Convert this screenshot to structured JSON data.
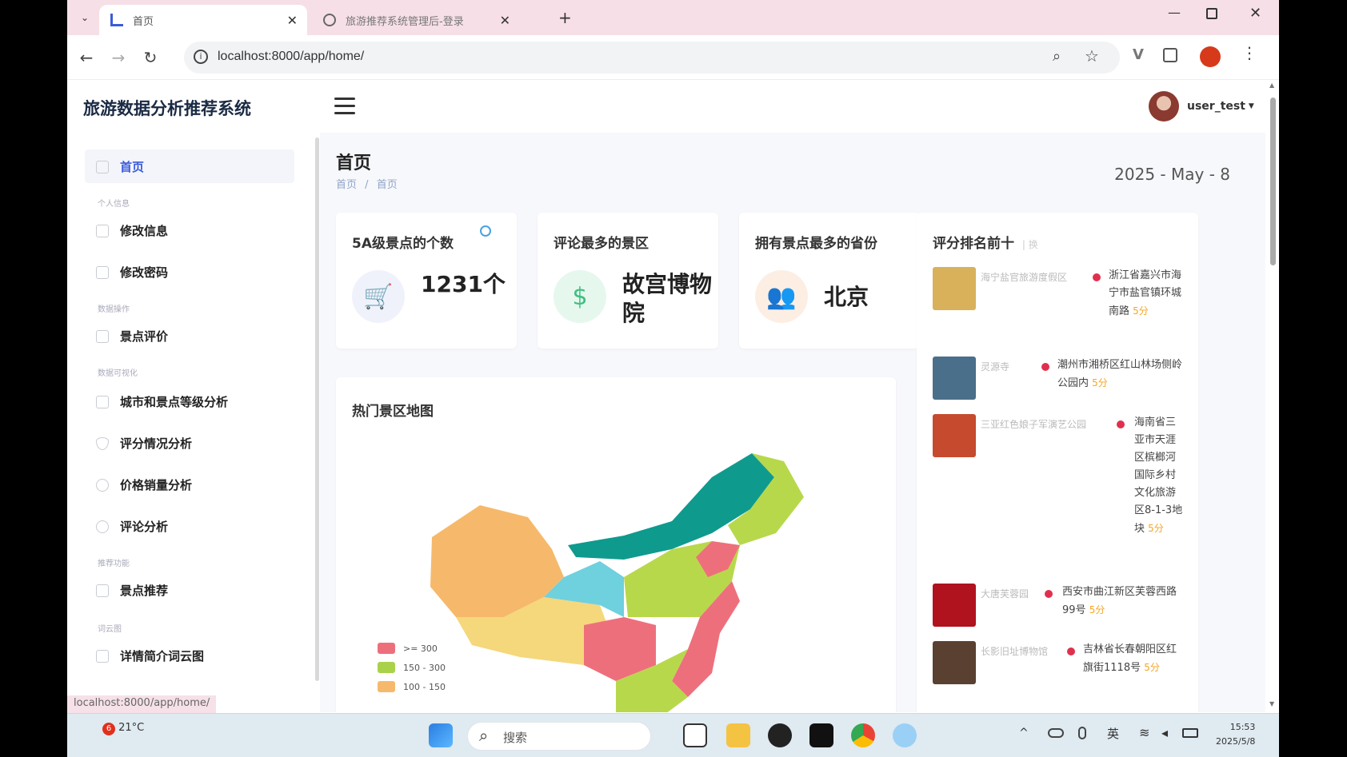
{
  "browser": {
    "tabs": [
      {
        "label": "首页",
        "active": true
      },
      {
        "label": "旅游推荐系统管理后-登录",
        "active": false
      }
    ],
    "new_tab": "+",
    "url": "localhost:8000/app/home/",
    "status_url": "localhost:8000/app/home/"
  },
  "app": {
    "title": "旅游数据分析推荐系统",
    "username": "user_test"
  },
  "sidebar": {
    "items": [
      {
        "label": "首页",
        "icon": "grid-icon"
      },
      {
        "label": "修改信息",
        "icon": "card-icon"
      },
      {
        "label": "修改密码",
        "icon": "document-icon"
      },
      {
        "label": "景点评价",
        "icon": "table-icon"
      },
      {
        "label": "城市和景点等级分析",
        "icon": "bar-chart-icon"
      },
      {
        "label": "评分情况分析",
        "icon": "shield-icon"
      },
      {
        "label": "价格销量分析",
        "icon": "user-icon"
      },
      {
        "label": "评论分析",
        "icon": "clock-icon"
      },
      {
        "label": "景点推荐",
        "icon": "mail-icon"
      },
      {
        "label": "详情简介词云图",
        "icon": "cloud-icon"
      }
    ]
  },
  "page": {
    "title": "首页",
    "breadcrumb_root": "首页",
    "breadcrumb_sep": "/",
    "breadcrumb_current": "首页",
    "date": "2025 - May - 8"
  },
  "stats": [
    {
      "title": "5A级景点的个数",
      "value": "1231个",
      "icon": "cart-icon",
      "color": "#5b72d8",
      "bg": "#f0f2fb"
    },
    {
      "title": "评论最多的景区",
      "value": "故宫博物院",
      "icon": "dollar-icon",
      "color": "#3fbf7f",
      "bg": "#e6f7ee"
    },
    {
      "title": "拥有景点最多的省份",
      "value": "北京",
      "icon": "users-icon",
      "color": "#f08a4b",
      "bg": "#fdeee4"
    }
  ],
  "map": {
    "title": "热门景区地图",
    "legend": [
      {
        "label": ">= 300",
        "color": "#ee6f7c"
      },
      {
        "label": "150 - 300",
        "color": "#a9d24a"
      },
      {
        "label": "100 - 150",
        "color": "#f6b96b"
      }
    ],
    "region_colors": [
      "#0f9a8e",
      "#b8d84c",
      "#f6b96b",
      "#6fd0de",
      "#f5d77c",
      "#ee6f7c"
    ]
  },
  "ranking": {
    "title": "评分排名前十",
    "more": "| 换",
    "items": [
      {
        "name": "海宁盐官旅游度假区",
        "address": "浙江省嘉兴市海宁市盐官镇环城南路",
        "score": "5分",
        "color": "#d9b15a"
      },
      {
        "name": "灵源寺",
        "address": "潮州市湘桥区红山林场侧岭公园内",
        "score": "5分",
        "color": "#4a6f8a"
      },
      {
        "name": "三亚红色娘子军演艺公园",
        "address": "海南省三亚市天涯区槟榔河国际乡村文化旅游区8-1-3地块",
        "score": "5分",
        "color": "#c64a2e"
      },
      {
        "name": "大唐芙蓉园",
        "address": "西安市曲江新区芙蓉西路99号",
        "score": "5分",
        "color": "#b0121e"
      },
      {
        "name": "长影旧址博物馆",
        "address": "吉林省长春朝阳区红旗街1118号",
        "score": "5分",
        "color": "#5a4030"
      }
    ]
  },
  "taskbar": {
    "temperature": "21°C",
    "weather_badge": "6",
    "search_placeholder": "搜索",
    "ime": "英",
    "time": "15:53",
    "date": "2025/5/8"
  }
}
